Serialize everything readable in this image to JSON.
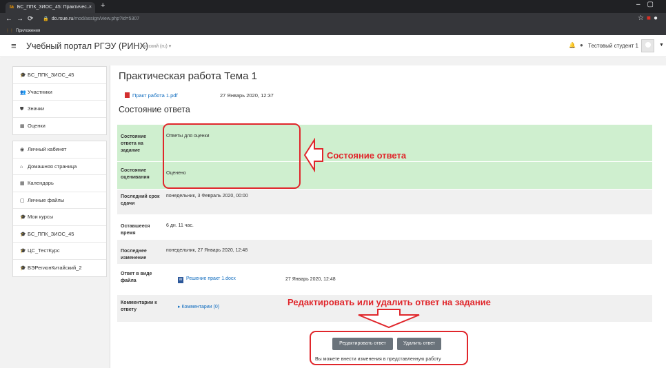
{
  "browser": {
    "tab_title": "БС_ППК_ЗИОС_45: Практичес...",
    "tab_favicon": "Ia",
    "new_tab_label": "+",
    "url_host": "do.rsue.ru",
    "url_path": "/mod/assign/view.php?id=5307",
    "bookmarks_label": "Приложения",
    "minimize_glyph": "–",
    "maximize_glyph": "▢"
  },
  "header": {
    "brand": "Учебный портал РГЭУ (РИНХ)",
    "language": "Русский (ru) ▾",
    "user_name": "Тестовый студент 1"
  },
  "drawer": {
    "course_items": [
      {
        "icon": "graduation-cap-icon",
        "glyph": "🎓",
        "label": "БС_ППК_ЗИОС_45"
      },
      {
        "icon": "users-icon",
        "glyph": "👥",
        "label": "Участники"
      },
      {
        "icon": "shield-icon",
        "glyph": "⛊",
        "label": "Значки"
      },
      {
        "icon": "table-icon",
        "glyph": "▦",
        "label": "Оценки"
      }
    ],
    "site_items": [
      {
        "icon": "dashboard-icon",
        "glyph": "◉",
        "label": "Личный кабинет"
      },
      {
        "icon": "home-icon",
        "glyph": "⌂",
        "label": "Домашняя страница"
      },
      {
        "icon": "calendar-icon",
        "glyph": "▦",
        "label": "Календарь"
      },
      {
        "icon": "file-icon",
        "glyph": "▢",
        "label": "Личные файлы"
      },
      {
        "icon": "graduation-cap-icon",
        "glyph": "🎓",
        "label": "Мои курсы"
      },
      {
        "icon": "graduation-cap-icon",
        "glyph": "🎓",
        "label": "БС_ППК_ЗИОС_45"
      },
      {
        "icon": "graduation-cap-icon",
        "glyph": "🎓",
        "label": "ЦС_ТестКурс"
      },
      {
        "icon": "graduation-cap-icon",
        "glyph": "🎓",
        "label": "ВЭРегионКитайский_2"
      }
    ]
  },
  "main": {
    "title": "Практическая работа Тема 1",
    "attachment_name": "Практ работа 1.pdf",
    "attachment_date": "27 Январь 2020, 12:37",
    "subtitle": "Состояние ответа",
    "rows": {
      "submission_status_label": "Состояние ответа на задание",
      "submission_status_value": "Ответы для оценки",
      "grading_status_label": "Состояние оценивания",
      "grading_status_value": "Оценено",
      "due_date_label": "Последний срок сдачи",
      "due_date_value": "понедельник, 3 Февраль 2020, 00:00",
      "time_remaining_label": "Оставшееся время",
      "time_remaining_value": "6 дн. 11 час.",
      "last_modified_label": "Последнее изменение",
      "last_modified_value": "понедельник, 27 Январь 2020, 12:48",
      "file_submission_label": "Ответ в виде файла",
      "file_submission_name": "Решение практ 1.docx",
      "file_submission_date": "27 Январь 2020, 12:48",
      "comments_label": "Комментарии к ответу",
      "comments_link": "Комментарии (0)"
    },
    "edit_button": "Редактировать ответ",
    "delete_button": "Удалить ответ",
    "note": "Вы можете внести изменения в представленную работу"
  },
  "annotations": {
    "status_callout": "Состояние ответа",
    "edit_callout": "Редактировать или удалить ответ на задание",
    "color": "#e0262b"
  }
}
